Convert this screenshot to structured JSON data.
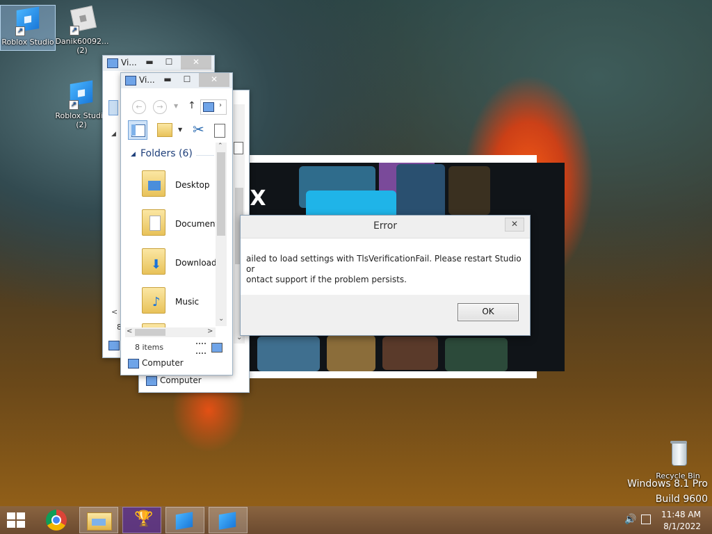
{
  "desktop": {
    "icons": [
      {
        "label": "Roblox Studio",
        "sub": ""
      },
      {
        "label": "Danik60092...",
        "sub": "(2)"
      },
      {
        "label": "Roblox Studio",
        "sub": "(2)"
      },
      {
        "label": "Recycle Bin",
        "sub": ""
      }
    ],
    "watermark_line1": "Windows 8.1 Pro",
    "watermark_line2": "Build 9600"
  },
  "explorer_back": {
    "title": "Vi...",
    "min": "▬",
    "max": "☐",
    "close": "✕",
    "status": "8",
    "computer_label": "Computer"
  },
  "explorer_front": {
    "title": "Vi...",
    "min": "▬",
    "max": "☐",
    "close": "✕",
    "group_header": "Folders (6)",
    "folders": [
      "Desktop",
      "Document",
      "Downloads",
      "Music"
    ],
    "status_count": "8 items",
    "computer_label": "Computer"
  },
  "explorer_third": {
    "computer_label": "Computer"
  },
  "splash": {
    "logo_text": "·X"
  },
  "error_dialog": {
    "title": "Error",
    "close": "✕",
    "message_line1": "ailed to load settings with TlsVerificationFail. Please restart Studio or",
    "message_line2": "ontact support if the problem persists.",
    "ok_label": "OK"
  },
  "taskbar": {
    "apps": [
      "start-button",
      "chrome",
      "file-explorer",
      "trophy-app",
      "roblox-studio",
      "roblox-studio"
    ],
    "time": "11:48 AM",
    "date": "8/1/2022"
  }
}
